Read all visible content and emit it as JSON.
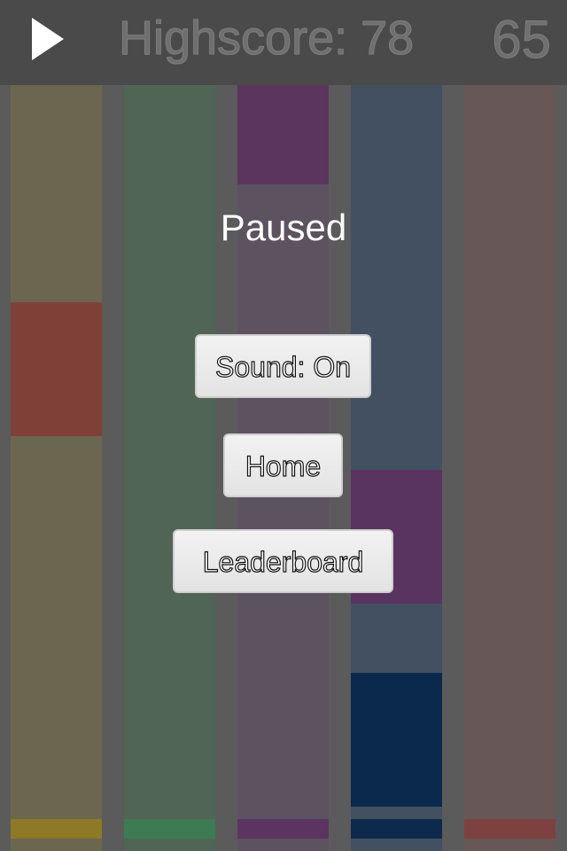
{
  "header": {
    "highscore_text": "Highscore: 78",
    "score_text": "65",
    "play_icon": "play-icon"
  },
  "pause_menu": {
    "title": "Paused",
    "sound_label": "Sound: On",
    "home_label": "Home",
    "leaderboard_label": "Leaderboard"
  },
  "lanes": [
    {
      "color": "#6b6650",
      "base_color": "#8e7a26",
      "blocks": [
        {
          "color": "#7f4038"
        }
      ]
    },
    {
      "color": "#516555",
      "base_color": "#3d7b52",
      "blocks": []
    },
    {
      "color": "#5d5260",
      "base_color": "#5c3462",
      "blocks": [
        {
          "color": "#5b355d"
        }
      ]
    },
    {
      "color": "#435061",
      "base_color": "#0d2a4c",
      "blocks": [
        {
          "color": "#5a3460"
        },
        {
          "color": "#0b294c"
        }
      ]
    },
    {
      "color": "#675756",
      "base_color": "#7d4240",
      "blocks": []
    }
  ]
}
